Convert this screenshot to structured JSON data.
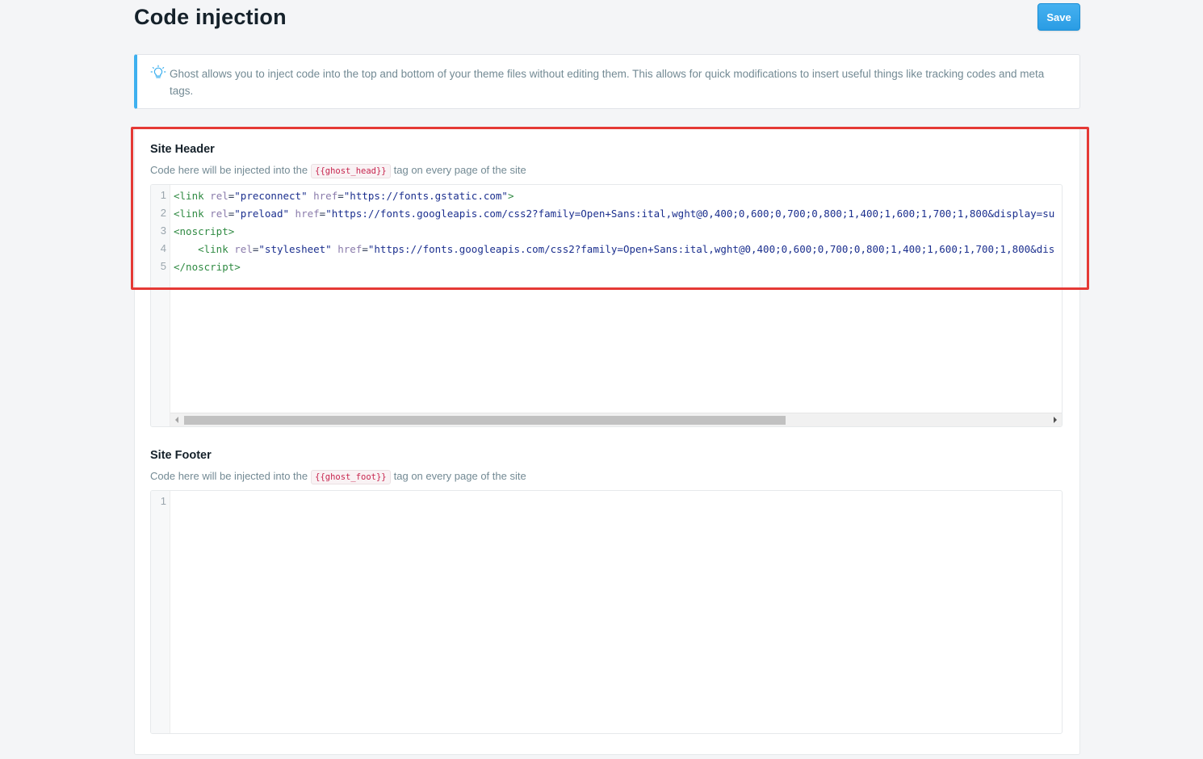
{
  "page": {
    "title": "Code injection"
  },
  "toolbar": {
    "save_label": "Save"
  },
  "info": {
    "icon": "lightbulb-icon",
    "accent": "#3eb0ef",
    "text": "Ghost allows you to inject code into the top and bottom of your theme files without editing them. This allows for quick modifications to insert useful things like tracking codes and meta tags."
  },
  "site_header": {
    "title": "Site Header",
    "desc_before": "Code here will be injected into the",
    "helper": "{{ghost_head}}",
    "desc_after": "tag on every page of the site",
    "line_numbers": [
      "1",
      "2",
      "3",
      "4",
      "5"
    ],
    "code_lines": [
      "<link rel=\"preconnect\" href=\"https://fonts.gstatic.com\">",
      "<link rel=\"preload\" href=\"https://fonts.googleapis.com/css2?family=Open+Sans:ital,wght@0,400;0,600;0,700;0,800;1,400;1,600;1,700;1,800&display=su",
      "<noscript>",
      "    <link rel=\"stylesheet\" href=\"https://fonts.googleapis.com/css2?family=Open+Sans:ital,wght@0,400;0,600;0,700;0,800;1,400;1,600;1,700;1,800&dis",
      "</noscript>"
    ],
    "scroll_position": 0.0
  },
  "site_footer": {
    "title": "Site Footer",
    "desc_before": "Code here will be injected into the",
    "helper": "{{ghost_foot}}",
    "desc_after": "tag on every page of the site",
    "line_numbers": [
      "1"
    ]
  },
  "highlight_color": "#e53935"
}
